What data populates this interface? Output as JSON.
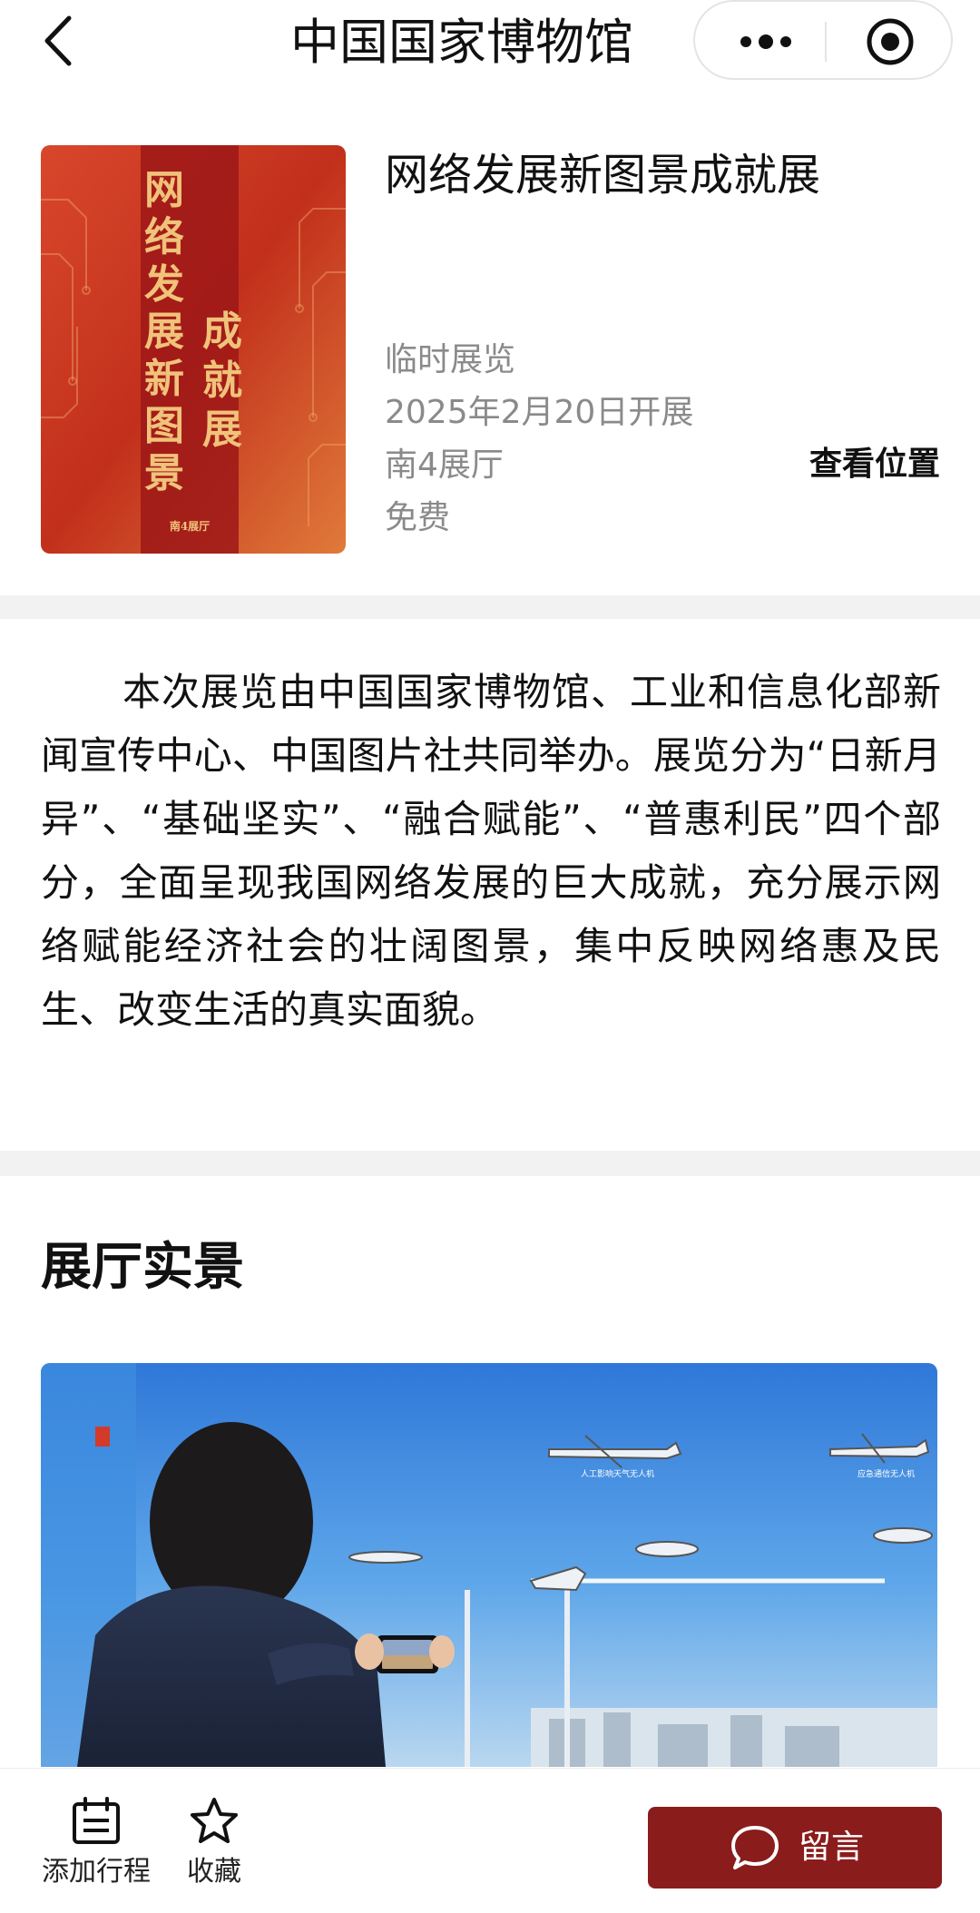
{
  "header": {
    "title": "中国国家博物馆",
    "back_icon": "chevron-left-icon",
    "more_icon": "more-dots-icon",
    "close_icon": "target-circle-icon"
  },
  "exhibition": {
    "title": "网络发展新图景成就展",
    "poster": {
      "col_left": [
        "网",
        "络",
        "发",
        "展",
        "新",
        "图",
        "景"
      ],
      "col_right": [
        "成",
        "就",
        "展"
      ],
      "hall_small": "南4展厅",
      "colors": {
        "bg": "#c4331f",
        "band": "#9e1818",
        "gold": "#f0c27a"
      }
    },
    "type": "临时展览",
    "date": "2025年2月20日开展",
    "hall": "南4展厅",
    "fee": "免费",
    "location_link": "查看位置"
  },
  "description": "本次展览由中国国家博物馆、工业和信息化部新闻宣传中心、中国图片社共同举办。展览分为“日新月异”、“基础坚实”、“融合赋能”、“普惠利民”四个部分，全面呈现我国网络发展的巨大成就，充分展示网络赋能经济社会的壮阔图景，集中反映网络惠及民生、改变生活的真实面貌。",
  "gallery": {
    "heading": "展厅实景",
    "photo_labels": [
      "人工影响天气无人机",
      "应急通信无人机"
    ]
  },
  "bottom_bar": {
    "add_schedule": "添加行程",
    "favorite": "收藏",
    "message_button": "留言",
    "accent": "#8b1c1c"
  }
}
